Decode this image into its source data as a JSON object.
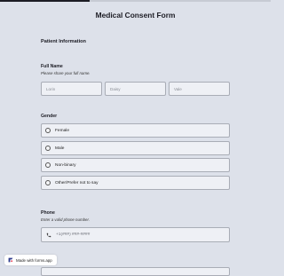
{
  "progress": {
    "fraction": 0.33
  },
  "form": {
    "title": "Medical Consent Form",
    "section_title": "Patient Information"
  },
  "full_name": {
    "label": "Full Name",
    "help": "Please share your full name.",
    "first_placeholder": "Lorin",
    "middle_placeholder": "Daisy",
    "last_placeholder": "Vale"
  },
  "gender": {
    "label": "Gender",
    "options": [
      "Female",
      "Male",
      "Non-binary",
      "Other/Prefer not to say"
    ]
  },
  "phone": {
    "label": "Phone",
    "help": "Enter a valid phone number.",
    "placeholder": "+1(###) ###-####",
    "icon": "phone-icon"
  },
  "badge": {
    "text": "Made with forms.app"
  },
  "colors": {
    "background": "#dde1ea",
    "field": "#eef0f5",
    "border": "#a9adb6",
    "text": "#1c1c24"
  }
}
